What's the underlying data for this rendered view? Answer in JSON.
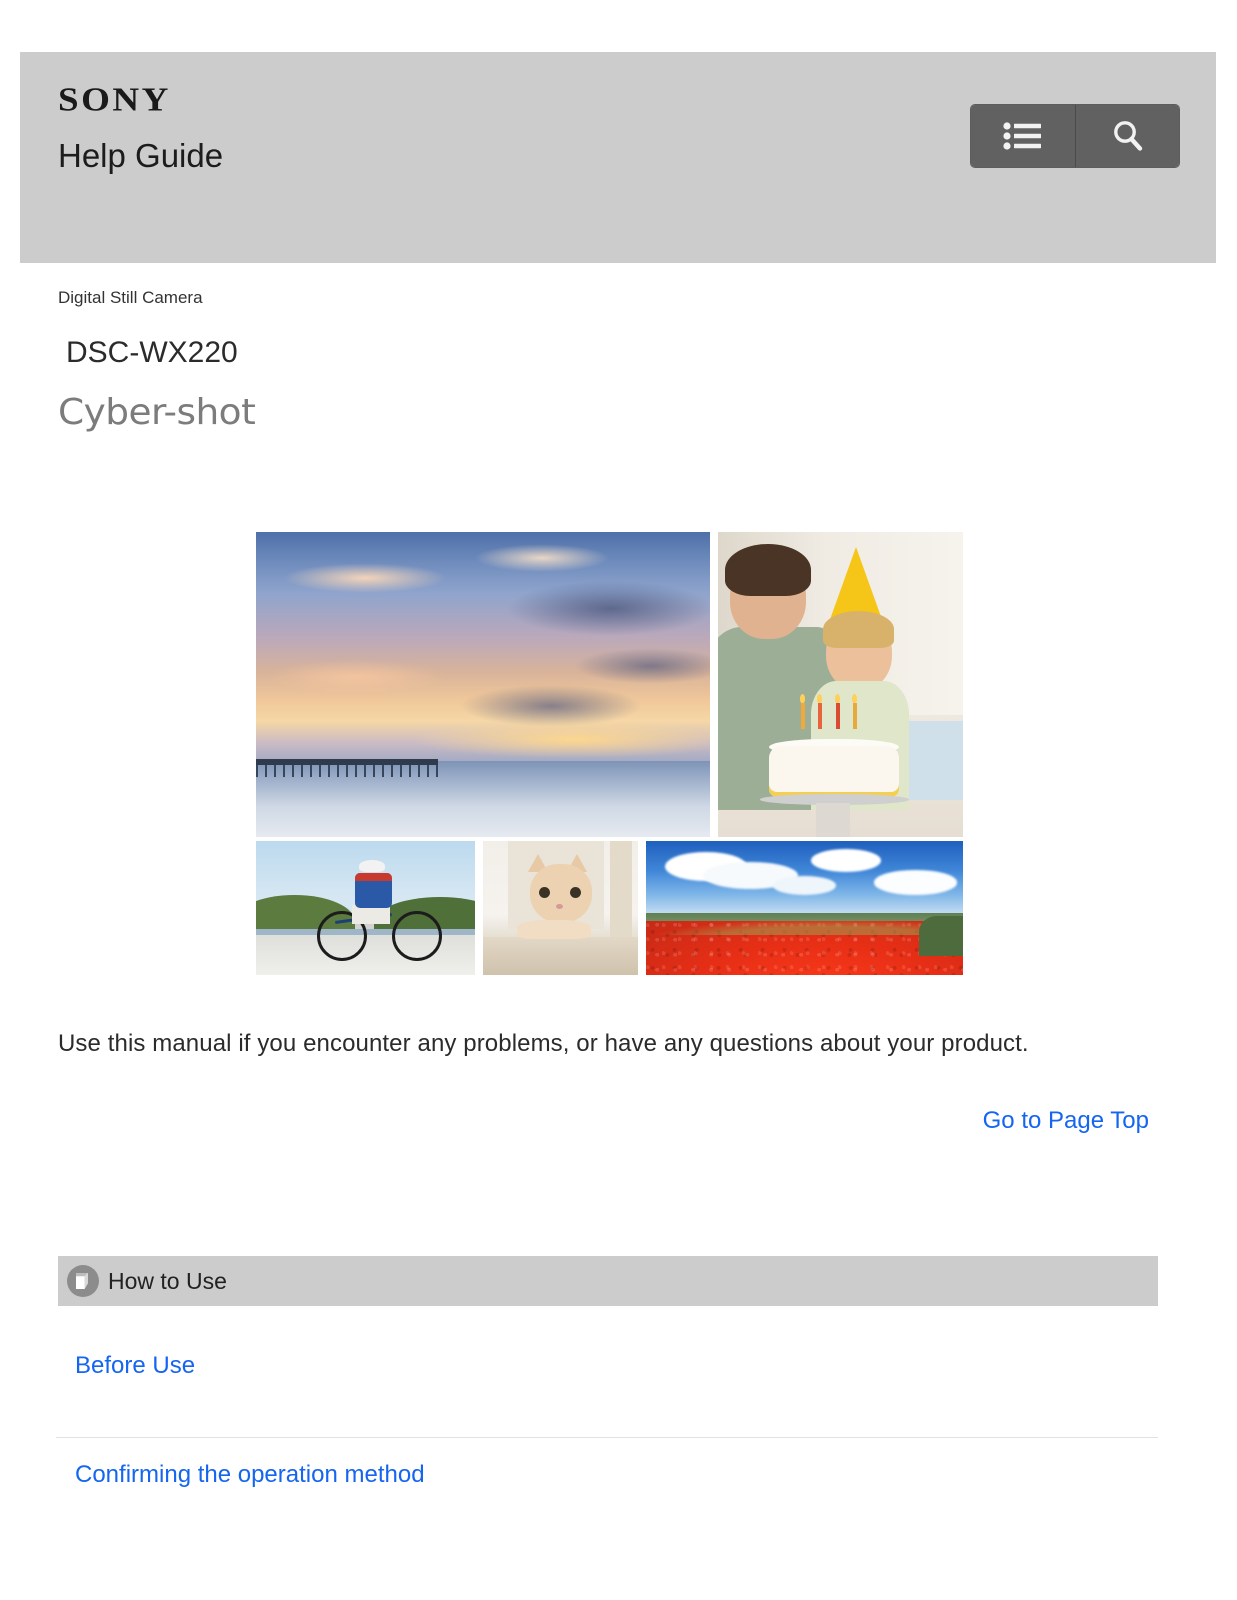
{
  "header": {
    "brand": "SONY",
    "title": "Help Guide",
    "buttons": [
      {
        "name": "menu-button",
        "icon": "list-icon",
        "label": ""
      },
      {
        "name": "search-button",
        "icon": "search-icon",
        "label": ""
      }
    ]
  },
  "product": {
    "category": "Digital Still Camera",
    "model": "DSC-WX220",
    "brand_logo": "Cyber-shot"
  },
  "collage": {
    "images": [
      {
        "name": "sunset-beach-photo",
        "alt": "Sunset over ocean with pier"
      },
      {
        "name": "birthday-party-photo",
        "alt": "Father and boy with birthday cake"
      },
      {
        "name": "cyclist-photo",
        "alt": "Cyclist riding on coastal road"
      },
      {
        "name": "cat-photo",
        "alt": "Cat peeking around a doorway"
      },
      {
        "name": "flower-field-photo",
        "alt": "Red flower field under blue sky"
      }
    ]
  },
  "main": {
    "intro": "Use this manual if you encounter any problems, or have any questions about your product.",
    "page_top_link": "Go to Page Top"
  },
  "how_to_use": {
    "section_label": "How to Use",
    "section_icon": "page-document-icon",
    "links": [
      {
        "label": "Before Use"
      },
      {
        "label": "Confirming the operation method"
      }
    ]
  },
  "colors": {
    "band_gray": "#cccccc",
    "button_gray": "#616161",
    "link_blue": "#1565f0",
    "text_dark": "#2b2b2b",
    "divider": "#e2e2e2"
  }
}
